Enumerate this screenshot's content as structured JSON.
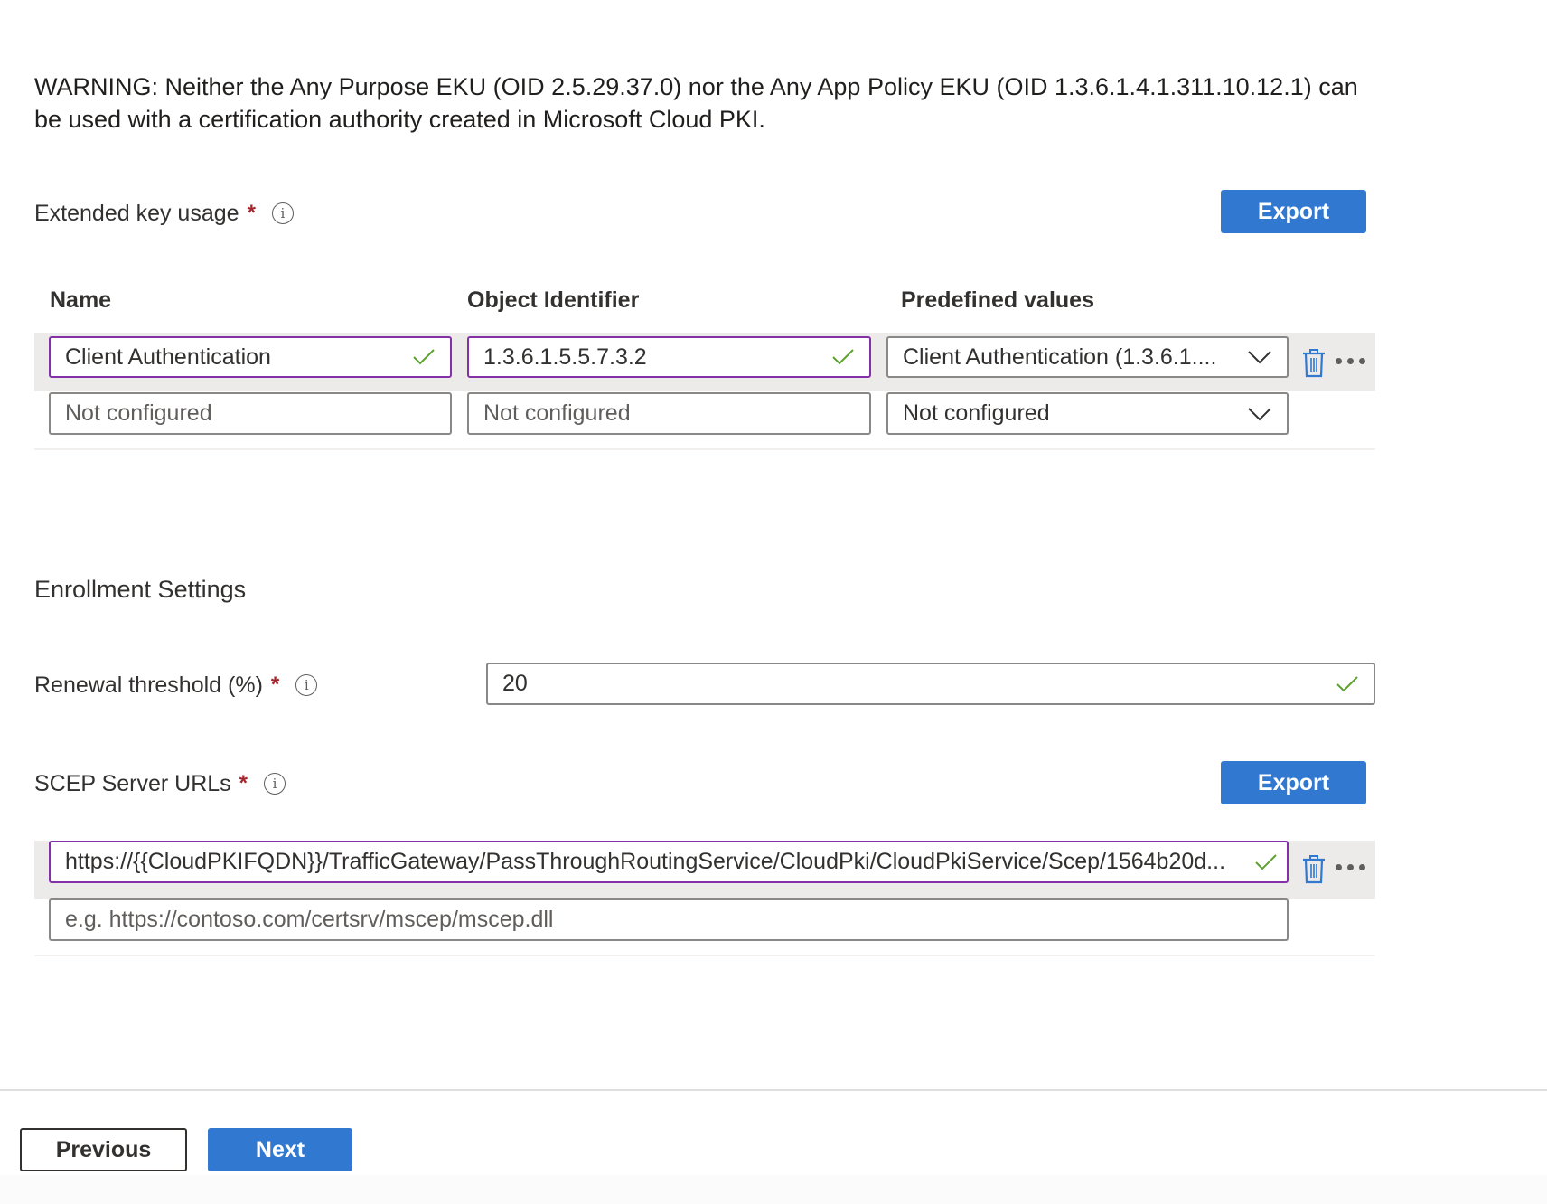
{
  "warning": {
    "text": "WARNING: Neither the Any Purpose EKU (OID 2.5.29.37.0) nor the Any App Policy EKU (OID 1.3.6.1.4.1.311.10.12.1) can be used with a certification authority created in Microsoft Cloud PKI."
  },
  "eku": {
    "label": "Extended key usage",
    "required_mark": "*",
    "info_icon": "info-icon",
    "export_label": "Export",
    "columns": {
      "name": "Name",
      "oid": "Object Identifier",
      "predefined": "Predefined values"
    },
    "rows": [
      {
        "name": "Client Authentication",
        "oid": "1.3.6.1.5.5.7.3.2",
        "predefined": "Client Authentication (1.3.6.1....",
        "valid": true
      },
      {
        "name_placeholder": "Not configured",
        "oid_placeholder": "Not configured",
        "predefined": "Not configured"
      }
    ]
  },
  "enrollment": {
    "title": "Enrollment Settings",
    "renewal": {
      "label": "Renewal threshold (%)",
      "required_mark": "*",
      "value": "20"
    }
  },
  "scep": {
    "label": "SCEP Server URLs",
    "required_mark": "*",
    "export_label": "Export",
    "rows": [
      {
        "value": "https://{{CloudPKIFQDN}}/TrafficGateway/PassThroughRoutingService/CloudPki/CloudPkiService/Scep/1564b20d...",
        "valid": true
      },
      {
        "placeholder": "e.g. https://contoso.com/certsrv/mscep/mscep.dll"
      }
    ]
  },
  "footer": {
    "previous_label": "Previous",
    "next_label": "Next"
  },
  "colors": {
    "primary": "#3178d0",
    "valid_border": "#8431a8",
    "valid_check": "#5ea12f",
    "required": "#a4262c"
  }
}
